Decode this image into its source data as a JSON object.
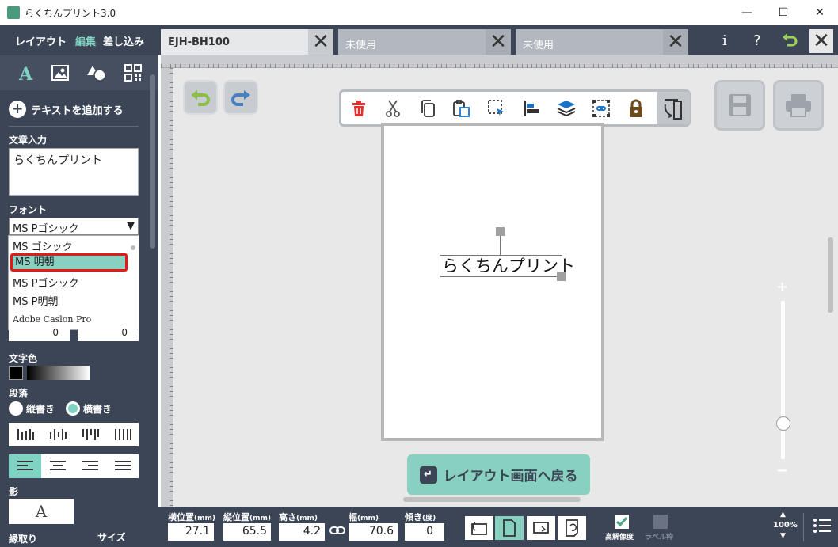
{
  "window": {
    "title": "らくちんプリント3.0",
    "minimize": "—",
    "maximize": "☐",
    "close": "✕"
  },
  "sidebar": {
    "mode_tabs": [
      "レイアウト",
      "編集",
      "差し込み"
    ],
    "active_mode": "編集",
    "tool_icons": [
      "text-icon",
      "image-icon",
      "shape-icon",
      "qrcode-icon"
    ],
    "add_text_label": "テキストを追加する",
    "text_input_label": "文章入力",
    "text_input_value": "らくちんプリント",
    "font_label": "フォント",
    "font_selected": "MS Pゴシック",
    "font_options": [
      "MS ゴシック",
      "MS 明朝",
      "MS Pゴシック",
      "MS P明朝",
      "Adobe Caslon Pro"
    ],
    "font_highlighted": "MS 明朝",
    "size_values": [
      "0",
      "0"
    ],
    "text_color_label": "文字色",
    "paragraph_label": "段落",
    "vertical_label": "縦書き",
    "horizontal_label": "横書き",
    "writing_mode": "横書き",
    "shadow_label": "影",
    "shadow_sample": "A",
    "outline_label": "縁取り",
    "size_label": "サイズ"
  },
  "tabs": [
    {
      "label": "EJH-BH100",
      "active": true
    },
    {
      "label": "未使用",
      "active": false
    },
    {
      "label": "未使用",
      "active": false
    }
  ],
  "top_icons": {
    "info": "i",
    "help": "?"
  },
  "canvas": {
    "text_object": "らくちんプリント",
    "back_button": "レイアウト画面へ戻る",
    "zoom_plus": "+",
    "zoom_minus": "−"
  },
  "toolbar": {
    "icons": [
      "delete-icon",
      "cut-icon",
      "copy-icon",
      "paste-icon",
      "select-icon",
      "align-icon",
      "layer-icon",
      "group-icon",
      "lock-icon",
      "rotate-icon"
    ]
  },
  "bottom": {
    "x_label": "横位置",
    "y_label": "縦位置",
    "h_label": "高さ",
    "w_label": "幅",
    "angle_label": "傾き",
    "mm_unit": "(mm)",
    "deg_unit": "(度)",
    "x_value": "27.1",
    "y_value": "65.5",
    "h_value": "4.2",
    "w_value": "70.6",
    "angle_value": "0",
    "hires_label": "高解像度",
    "label_frame_label": "ラベル枠",
    "zoom_level": "100%"
  },
  "colors": {
    "panel": "#3c4555",
    "accent": "#88d1c0",
    "highlight_border": "#e21a1a",
    "delete": "#e03030",
    "lock": "#6b4a1e"
  }
}
